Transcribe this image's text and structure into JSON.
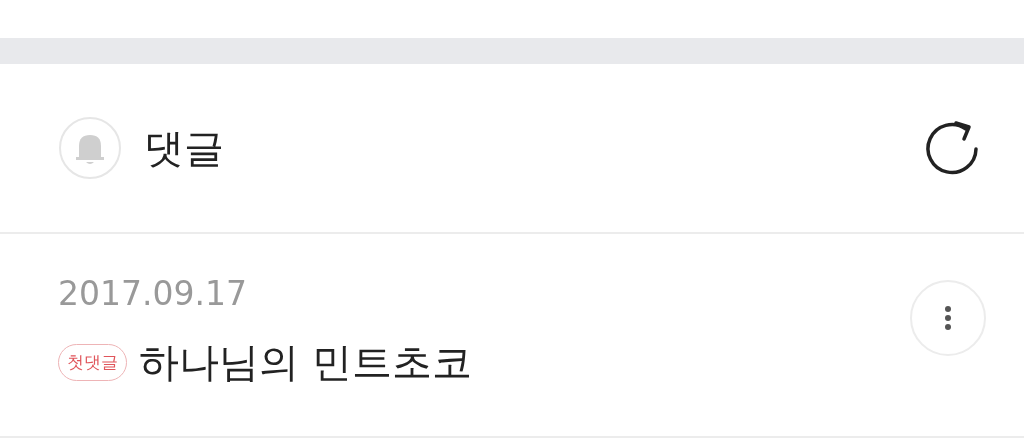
{
  "header": {
    "title": "댓글"
  },
  "comments": [
    {
      "date": "2017.09.17",
      "badge": "첫댓글",
      "text": "하나님의 민트초코"
    }
  ]
}
